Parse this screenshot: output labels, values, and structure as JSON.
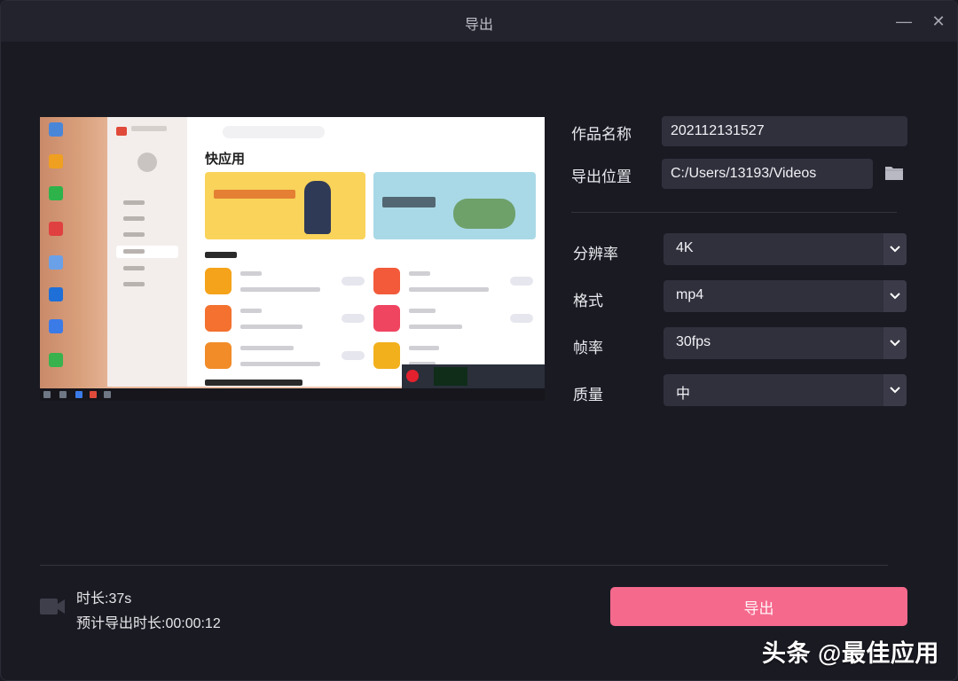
{
  "window": {
    "title": "导出",
    "minimize_icon": "minimize-icon",
    "close_icon": "close-icon"
  },
  "preview": {
    "app_heading": "快应用"
  },
  "form": {
    "name_label": "作品名称",
    "name_value": "202112131527",
    "location_label": "导出位置",
    "location_value": "C:/Users/13193/Videos",
    "folder_icon": "folder-icon",
    "resolution_label": "分辨率",
    "resolution_value": "4K",
    "format_label": "格式",
    "format_value": "mp4",
    "framerate_label": "帧率",
    "framerate_value": "30fps",
    "quality_label": "质量",
    "quality_value": "中"
  },
  "footer": {
    "video_icon": "video-camera-icon",
    "duration": "时长:37s",
    "estimated": "预计导出时长:00:00:12",
    "export_label": "导出",
    "accent": "#f5698d"
  },
  "watermark": "头条 @最佳应用"
}
